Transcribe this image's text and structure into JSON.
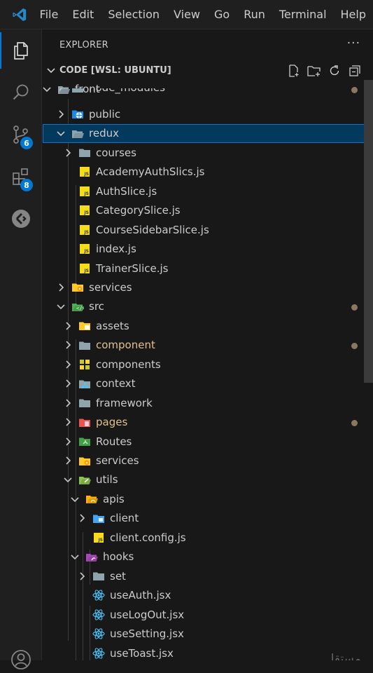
{
  "menu": [
    "File",
    "Edit",
    "Selection",
    "View",
    "Go",
    "Run",
    "Terminal",
    "Help"
  ],
  "activity_bar": {
    "items": [
      {
        "name": "explorer",
        "icon": "files-icon",
        "active": true
      },
      {
        "name": "search",
        "icon": "search-icon"
      },
      {
        "name": "source-control",
        "icon": "source-control-icon",
        "badge": "6"
      },
      {
        "name": "extensions",
        "icon": "extensions-icon",
        "badge": "8"
      },
      {
        "name": "remote",
        "icon": "remote-icon"
      }
    ],
    "account_icon": "account-icon"
  },
  "explorer": {
    "title": "EXPLORER",
    "more": "···",
    "section_title": "CODE [WSL: UBUNTU]",
    "section_actions": [
      "new-file-icon",
      "new-folder-icon",
      "refresh-icon",
      "collapse-all-icon"
    ]
  },
  "tree": [
    {
      "label": "front",
      "depth": 0,
      "kind": "folder",
      "open": true,
      "modified": false,
      "dot": true
    },
    {
      "label": "node_modules",
      "depth": 1,
      "kind": "folder",
      "open": false,
      "partial": true
    },
    {
      "label": "public",
      "depth": 1,
      "kind": "public",
      "open": false
    },
    {
      "label": "redux",
      "depth": 1,
      "kind": "folder",
      "open": true,
      "selected": true
    },
    {
      "label": "courses",
      "depth": 2,
      "kind": "folder",
      "open": false
    },
    {
      "label": "AcademyAuthSlics.js",
      "depth": 2,
      "kind": "js"
    },
    {
      "label": "AuthSlice.js",
      "depth": 2,
      "kind": "js"
    },
    {
      "label": "CategorySlice.js",
      "depth": 2,
      "kind": "js"
    },
    {
      "label": "CourseSidebarSlice.js",
      "depth": 2,
      "kind": "js"
    },
    {
      "label": "index.js",
      "depth": 2,
      "kind": "js"
    },
    {
      "label": "TrainerSlice.js",
      "depth": 2,
      "kind": "js"
    },
    {
      "label": "services",
      "depth": 1,
      "kind": "services",
      "open": false
    },
    {
      "label": "src",
      "depth": 1,
      "kind": "src",
      "open": true,
      "dot": true
    },
    {
      "label": "assets",
      "depth": 2,
      "kind": "assets",
      "open": false
    },
    {
      "label": "component",
      "depth": 2,
      "kind": "folder",
      "open": false,
      "modified": true,
      "dot": true
    },
    {
      "label": "components",
      "depth": 2,
      "kind": "components",
      "open": false
    },
    {
      "label": "context",
      "depth": 2,
      "kind": "context",
      "open": false
    },
    {
      "label": "framework",
      "depth": 2,
      "kind": "folder",
      "open": false
    },
    {
      "label": "pages",
      "depth": 2,
      "kind": "pages",
      "open": false,
      "modified": true,
      "dot": true
    },
    {
      "label": "Routes",
      "depth": 2,
      "kind": "routes",
      "open": false
    },
    {
      "label": "services",
      "depth": 2,
      "kind": "services",
      "open": false
    },
    {
      "label": "utils",
      "depth": 2,
      "kind": "utils",
      "open": true
    },
    {
      "label": "apis",
      "depth": 3,
      "kind": "apis",
      "open": true
    },
    {
      "label": "client",
      "depth": 4,
      "kind": "client",
      "open": false
    },
    {
      "label": "client.config.js",
      "depth": 4,
      "kind": "js"
    },
    {
      "label": "hooks",
      "depth": 3,
      "kind": "hooks",
      "open": true
    },
    {
      "label": "set",
      "depth": 4,
      "kind": "folder",
      "open": false
    },
    {
      "label": "useAuth.jsx",
      "depth": 4,
      "kind": "react"
    },
    {
      "label": "useLogOut.jsx",
      "depth": 4,
      "kind": "react"
    },
    {
      "label": "useSetting.jsx",
      "depth": 4,
      "kind": "react"
    },
    {
      "label": "useToast.jsx",
      "depth": 4,
      "kind": "react"
    }
  ],
  "watermark": "مستقل",
  "colors": {
    "accent": "#0078d4",
    "selection": "#04395e",
    "modified": "#e2c08d",
    "js": "#f5de19",
    "react": "#4fc3f7",
    "folder": "#90a4ae"
  }
}
